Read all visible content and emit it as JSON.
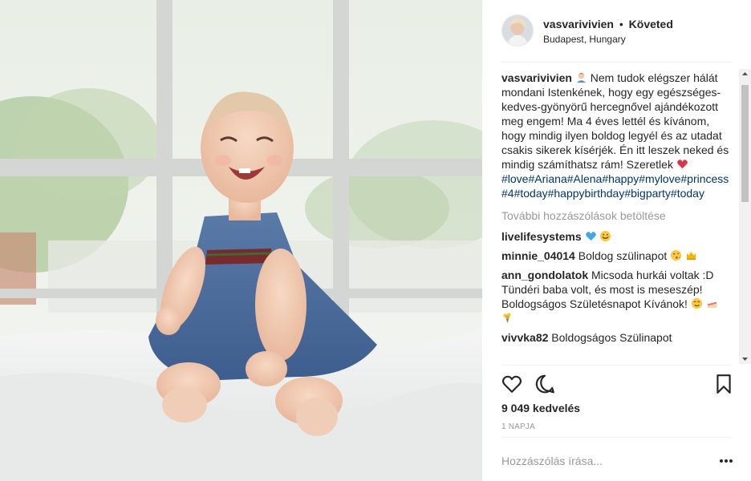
{
  "post": {
    "author": {
      "username": "vasvarivivien",
      "separator": "•",
      "follow_label": "Követed",
      "location": "Budapest, Hungary"
    },
    "caption": {
      "author": "vasvarivivien",
      "text": "Nem tudok elégszer hálát mondani Istenkének, hogy egy egészséges-kedves-gyönyörű hercegnővel ajándékozott meg engem! Ma 4 éves lettél és kívánom, hogy mindig ilyen boldog legyél és az utadat csakis sikerek kísérjék. Én itt leszek neked és mindig számíthatsz rám! Szeretlek",
      "hashtags": "#love#Ariana#Alena#happy#mylove#princess#4#today#happybirthday#bigparty#today"
    },
    "load_more_label": "További hozzászólások betöltése",
    "comments": [
      {
        "author": "livelifesystems",
        "text": ""
      },
      {
        "author": "minnie_04014",
        "text": "Boldog szülinapot"
      },
      {
        "author": "ann_gondolatok",
        "text": "Micsoda hurkái voltak :D Tündéri baba volt, és most is meseszép! Boldogságos Születésnapot Kívánok!"
      },
      {
        "author": "vivvka82",
        "text": "Boldogságos Szülinapot"
      }
    ],
    "likes_label": "9 049 kedvelés",
    "timestamp": "1 NAPJA",
    "add_comment_placeholder": "Hozzászólás írása...",
    "more_label": "•••"
  },
  "icons": {
    "like": "heart-outline-icon",
    "comment": "comment-bubble-icon",
    "save": "bookmark-icon",
    "more": "more-dots-icon"
  },
  "colors": {
    "text": "#262626",
    "secondary": "#999999",
    "hashtag": "#003569",
    "divider": "#efefef"
  }
}
